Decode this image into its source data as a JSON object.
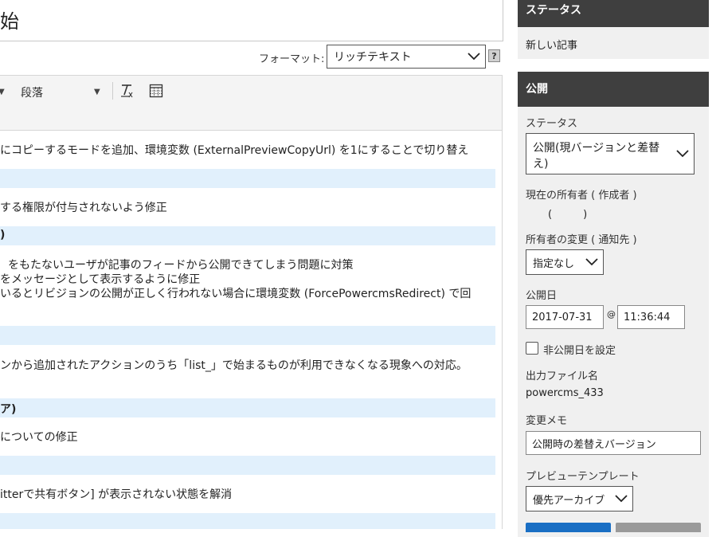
{
  "entry": {
    "title_fragment": "始"
  },
  "format": {
    "label": "フォーマット:",
    "selected": "リッチテキスト",
    "help": "?"
  },
  "toolbar": {
    "paragraph": "段落"
  },
  "content": {
    "lines": [
      "にコピーするモードを追加、環境変数 (ExternalPreviewCopyUrl) を1にすることで切り替え",
      "する権限が付与されないよう修正",
      "をもたないユーザが記事のフィードから公開できてしまう問題に対策",
      "をメッセージとして表示するように修正",
      "いるとリビジョンの公開が正しく行われない場合に環境変数 (ForcePowercmsRedirect) で回",
      "ンから追加されたアクションのうち「list_」で始まるものが利用できなくなる現象への対応。",
      "についての修正",
      "itterで共有ボタン] が表示されない状態を解消"
    ],
    "headings": [
      ")",
      "ア)"
    ]
  },
  "sidebar": {
    "status_header": "ステータス",
    "status_value": "新しい記事",
    "publish_header": "公開",
    "status_label": "ステータス",
    "status_select": "公開(現バージョンと差替え)",
    "owner_label": "現在の所有者 ( 作成者 )",
    "owner_value": "(　　　)",
    "owner_change_label": "所有者の変更 ( 通知先 )",
    "owner_change_select": "指定なし",
    "publish_date_label": "公開日",
    "publish_date": "2017-07-31",
    "at": "@",
    "publish_time": "11:36:44",
    "unpublish_label": "非公開日を設定",
    "output_file_label": "出力ファイル名",
    "output_file": "powercms_433",
    "memo_label": "変更メモ",
    "memo_value": "公開時の差替えバージョン",
    "preview_label": "プレビューテンプレート",
    "preview_select": "優先アーカイブ"
  }
}
